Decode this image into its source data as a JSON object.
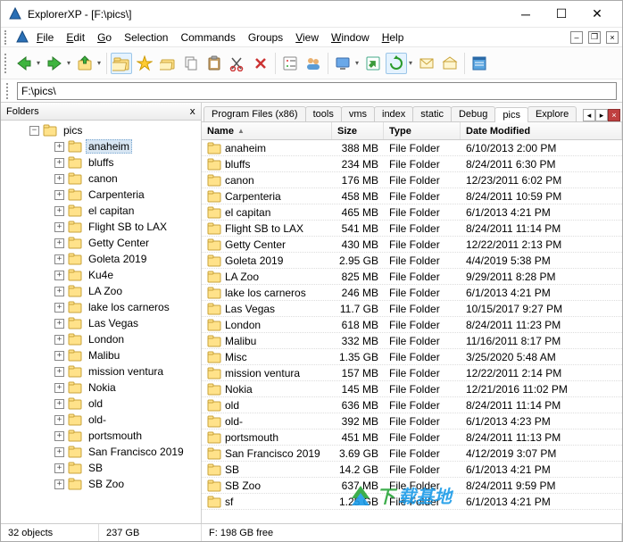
{
  "window": {
    "title": "ExplorerXP - [F:\\pics\\]"
  },
  "menu": {
    "file": "File",
    "edit": "Edit",
    "go": "Go",
    "selection": "Selection",
    "commands": "Commands",
    "groups": "Groups",
    "view": "View",
    "window": "Window",
    "help": "Help"
  },
  "address": {
    "value": "F:\\pics\\"
  },
  "folders_header": {
    "label": "Folders",
    "close": "x"
  },
  "tree": {
    "root": "pics",
    "items": [
      "anaheim",
      "bluffs",
      "canon",
      "Carpenteria",
      "el capitan",
      "Flight SB to LAX",
      "Getty Center",
      "Goleta 2019",
      "Ku4e",
      "LA Zoo",
      "lake los carneros",
      "Las Vegas",
      "London",
      "Malibu",
      "mission ventura",
      "Nokia",
      "old",
      "old-",
      "portsmouth",
      "San Francisco 2019",
      "SB",
      "SB Zoo"
    ],
    "selected": "anaheim"
  },
  "tabs": {
    "items": [
      "Program Files (x86)",
      "tools",
      "vms",
      "index",
      "static",
      "Debug",
      "pics",
      "Explore"
    ],
    "active": "pics"
  },
  "columns": {
    "name": "Name",
    "size": "Size",
    "type": "Type",
    "date": "Date Modified"
  },
  "rows": [
    {
      "name": "anaheim",
      "size": "388 MB",
      "type": "File Folder",
      "date": "6/10/2013 2:00 PM"
    },
    {
      "name": "bluffs",
      "size": "234 MB",
      "type": "File Folder",
      "date": "8/24/2011 6:30 PM"
    },
    {
      "name": "canon",
      "size": "176 MB",
      "type": "File Folder",
      "date": "12/23/2011 6:02 PM"
    },
    {
      "name": "Carpenteria",
      "size": "458 MB",
      "type": "File Folder",
      "date": "8/24/2011 10:59 PM"
    },
    {
      "name": "el capitan",
      "size": "465 MB",
      "type": "File Folder",
      "date": "6/1/2013 4:21 PM"
    },
    {
      "name": "Flight SB to LAX",
      "size": "541 MB",
      "type": "File Folder",
      "date": "8/24/2011 11:14 PM"
    },
    {
      "name": "Getty Center",
      "size": "430 MB",
      "type": "File Folder",
      "date": "12/22/2011 2:13 PM"
    },
    {
      "name": "Goleta 2019",
      "size": "2.95 GB",
      "type": "File Folder",
      "date": "4/4/2019 5:38 PM"
    },
    {
      "name": "LA Zoo",
      "size": "825 MB",
      "type": "File Folder",
      "date": "9/29/2011 8:28 PM"
    },
    {
      "name": "lake los carneros",
      "size": "246 MB",
      "type": "File Folder",
      "date": "6/1/2013 4:21 PM"
    },
    {
      "name": "Las Vegas",
      "size": "11.7 GB",
      "type": "File Folder",
      "date": "10/15/2017 9:27 PM"
    },
    {
      "name": "London",
      "size": "618 MB",
      "type": "File Folder",
      "date": "8/24/2011 11:23 PM"
    },
    {
      "name": "Malibu",
      "size": "332 MB",
      "type": "File Folder",
      "date": "11/16/2011 8:17 PM"
    },
    {
      "name": "Misc",
      "size": "1.35 GB",
      "type": "File Folder",
      "date": "3/25/2020 5:48 AM"
    },
    {
      "name": "mission ventura",
      "size": "157 MB",
      "type": "File Folder",
      "date": "12/22/2011 2:14 PM"
    },
    {
      "name": "Nokia",
      "size": "145 MB",
      "type": "File Folder",
      "date": "12/21/2016 11:02 PM"
    },
    {
      "name": "old",
      "size": "636 MB",
      "type": "File Folder",
      "date": "8/24/2011 11:14 PM"
    },
    {
      "name": "old-",
      "size": "392 MB",
      "type": "File Folder",
      "date": "6/1/2013 4:23 PM"
    },
    {
      "name": "portsmouth",
      "size": "451 MB",
      "type": "File Folder",
      "date": "8/24/2011 11:13 PM"
    },
    {
      "name": "San Francisco 2019",
      "size": "3.69 GB",
      "type": "File Folder",
      "date": "4/12/2019 3:07 PM"
    },
    {
      "name": "SB",
      "size": "14.2 GB",
      "type": "File Folder",
      "date": "6/1/2013 4:21 PM"
    },
    {
      "name": "SB Zoo",
      "size": "637 MB",
      "type": "File Folder",
      "date": "8/24/2011 9:59 PM"
    },
    {
      "name": "sf",
      "size": "1.25 GB",
      "type": "File Folder",
      "date": "6/1/2013 4:21 PM"
    }
  ],
  "status": {
    "objects": "32 objects",
    "size": "237 GB",
    "free": "F: 198 GB free"
  },
  "watermark": {
    "text": "下载基地"
  }
}
